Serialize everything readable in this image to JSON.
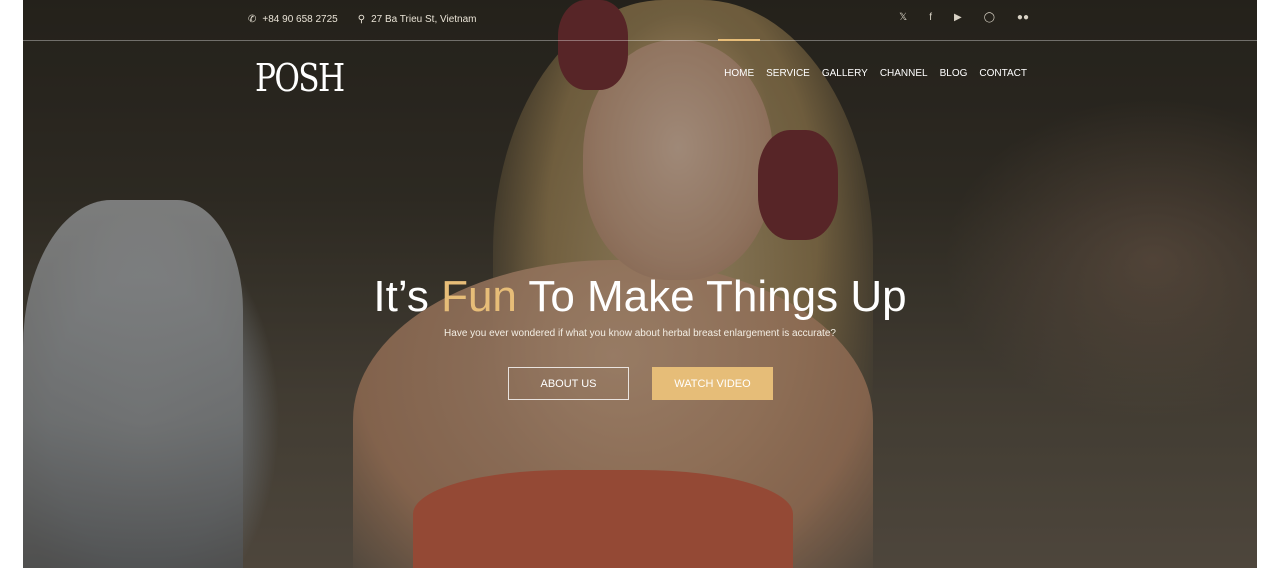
{
  "topbar": {
    "phone": "+84 90 658 2725",
    "address": "27 Ba Trieu St, Vietnam",
    "icons": [
      "phone-icon",
      "location-pin-icon"
    ],
    "social": [
      "twitter-icon",
      "facebook-icon",
      "youtube-icon",
      "instagram-icon",
      "flickr-icon"
    ]
  },
  "brand": {
    "logo": "POSH"
  },
  "nav": {
    "items": [
      "HOME",
      "SERVICE",
      "GALLERY",
      "CHANNEL",
      "BLOG",
      "CONTACT"
    ],
    "active": "HOME"
  },
  "hero": {
    "title_before": "It’s ",
    "title_accent": "Fun",
    "title_after": " To Make Things Up",
    "subtitle": "Have you ever wondered if what you know about herbal breast enlargement is accurate?",
    "btn_about": "ABOUT US",
    "btn_watch": "WATCH VIDEO"
  },
  "colors": {
    "accent": "#e7bd78",
    "text": "#ffffff"
  }
}
